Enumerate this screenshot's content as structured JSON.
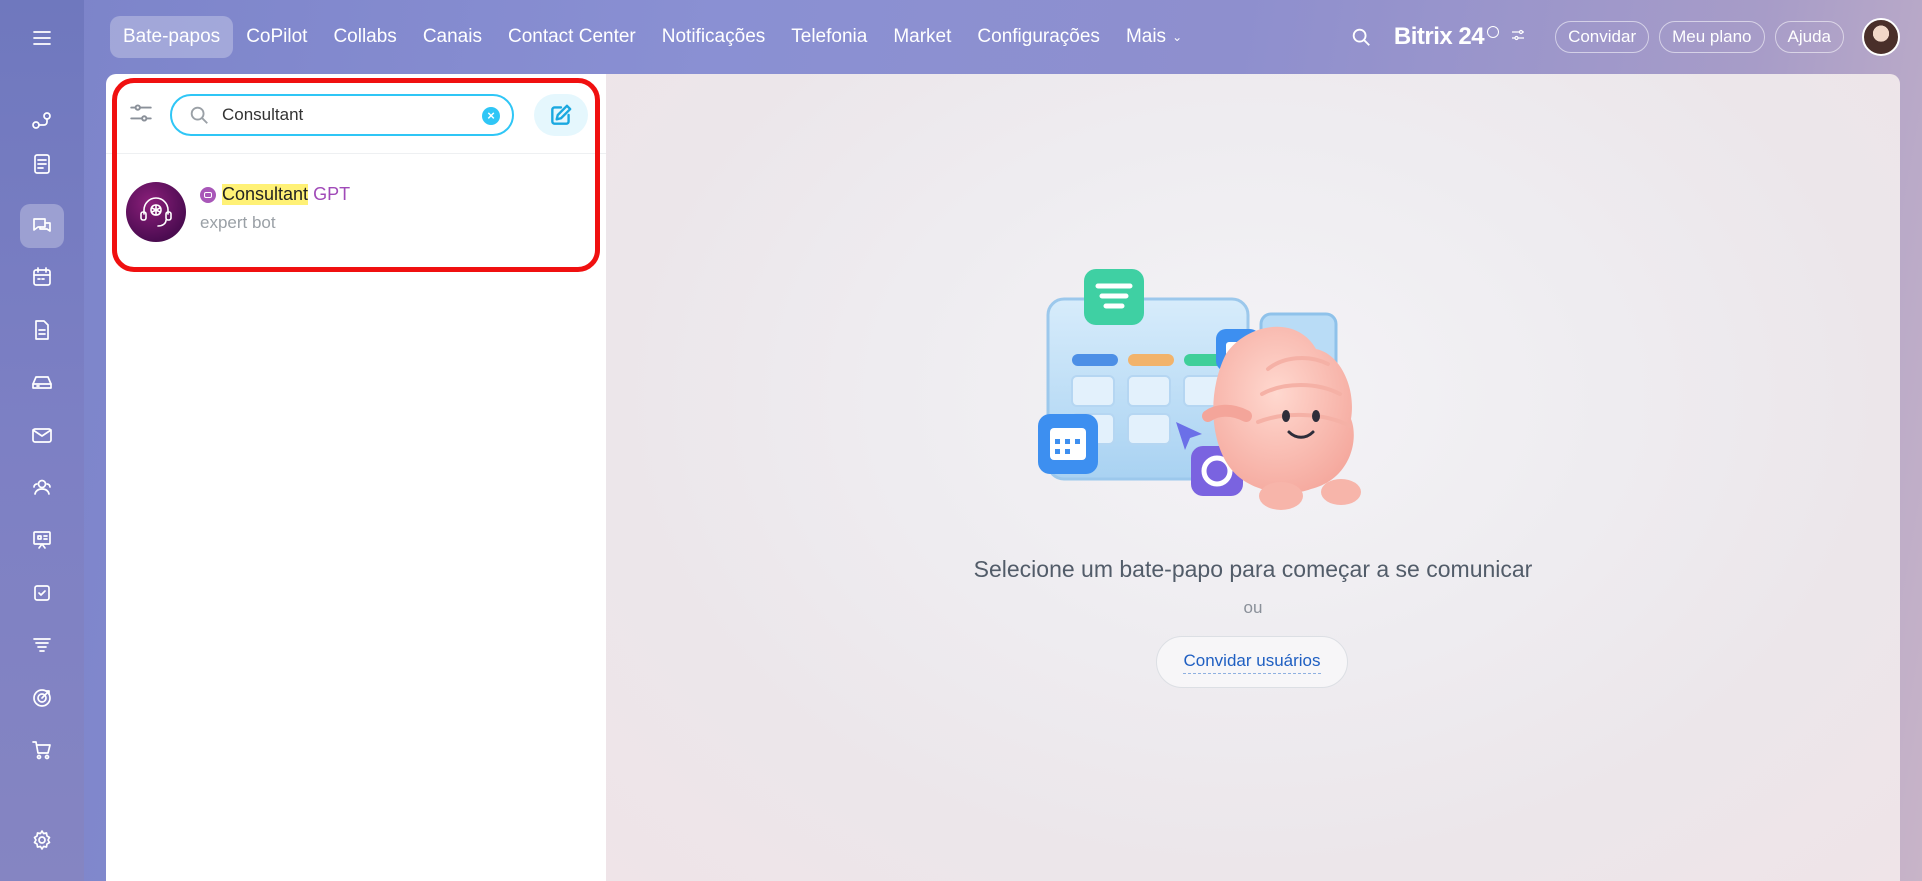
{
  "nav": {
    "items": [
      {
        "label": "Bate-papos",
        "active": true
      },
      {
        "label": "CoPilot"
      },
      {
        "label": "Collabs"
      },
      {
        "label": "Canais"
      },
      {
        "label": "Contact Center"
      },
      {
        "label": "Notificações"
      },
      {
        "label": "Telefonia"
      },
      {
        "label": "Market"
      },
      {
        "label": "Configurações"
      },
      {
        "label": "Mais"
      }
    ]
  },
  "header": {
    "brand": "Bitrix 24",
    "invite_label": "Convidar",
    "plan_label": "Meu plano",
    "help_label": "Ajuda"
  },
  "sidebar": {
    "icons": [
      "menu-icon",
      "flow-icon",
      "feed-icon",
      "chat-icon",
      "calendar-icon",
      "document-icon",
      "drive-icon",
      "mail-icon",
      "contacts-icon",
      "presentation-icon",
      "tasks-icon",
      "funnel-icon",
      "target-icon",
      "cart-icon",
      "settings-icon"
    ],
    "active": "chat-icon"
  },
  "search": {
    "value": "Consultant",
    "placeholder": ""
  },
  "result": {
    "highlight": "Consultant",
    "rest": "GPT",
    "subtitle": "expert bot"
  },
  "empty_state": {
    "title": "Selecione um bate-papo para começar a se comunicar",
    "or": "ou",
    "invite_button": "Convidar usuários"
  },
  "colors": {
    "accent": "#2fc6f6",
    "highlight": "#fff176",
    "bot_name": "#a04ab8",
    "outline": "#f01010"
  }
}
